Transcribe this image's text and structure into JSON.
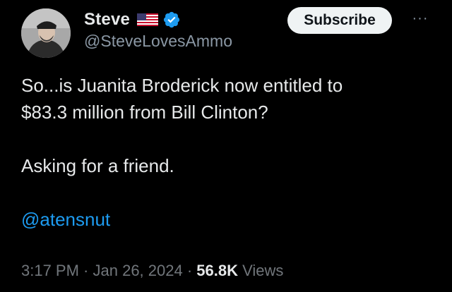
{
  "author": {
    "display_name": "Steve",
    "handle": "@SteveLovesAmmo",
    "avatar_icon": "user-avatar-photo",
    "flag_icon": "us-flag-icon",
    "verified_icon": "verified-badge-icon"
  },
  "actions": {
    "subscribe_label": "Subscribe",
    "more_label": "···"
  },
  "tweet": {
    "line1": "So...is Juanita Broderick now entitled to",
    "line2": "$83.3 million from Bill Clinton?",
    "line3": "Asking for a friend.",
    "mention": "@atensnut"
  },
  "meta": {
    "time": "3:17 PM",
    "separator1": " · ",
    "date": "Jan 26, 2024",
    "separator2": " · ",
    "views_count": "56.8K",
    "views_label": " Views"
  },
  "colors": {
    "background": "#000000",
    "text": "#e7e9ea",
    "secondary_text": "#71767b",
    "link": "#1d9bf0",
    "verified": "#1d9bf0",
    "subscribe_bg": "#eff3f4"
  }
}
